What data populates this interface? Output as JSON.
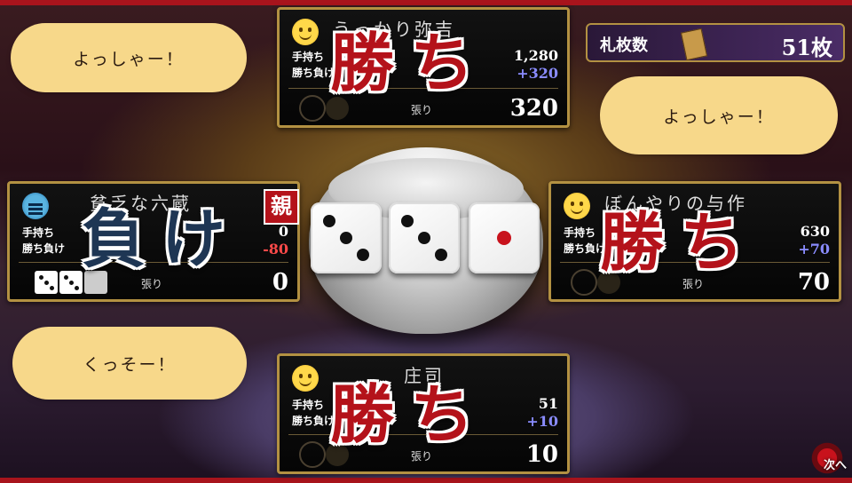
{
  "counter": {
    "label": "札枚数",
    "value": "51枚"
  },
  "players": {
    "top": {
      "name": "うっかり弥吉",
      "hand_label": "手持ち",
      "result_label": "勝ち負け",
      "hand": "1,280",
      "delta": "+320",
      "bet_label": "張り",
      "bet": "320",
      "result": "勝ち"
    },
    "left": {
      "name": "貧乏な六蔵",
      "hand_label": "手持ち",
      "result_label": "勝ち負け",
      "hand": "0",
      "delta": "-80",
      "bet_label": "張り",
      "bet": "0",
      "result": "負け",
      "dealer_badge": "親"
    },
    "right": {
      "name": "ぼんやりの与作",
      "hand_label": "手持ち",
      "result_label": "勝ち負け",
      "hand": "630",
      "delta": "+70",
      "bet_label": "張り",
      "bet": "70",
      "result": "勝ち"
    },
    "bottom": {
      "name": "庄司",
      "hand_label": "手持ち",
      "result_label": "勝ち負け",
      "hand": "51",
      "delta": "+10",
      "bet_label": "張り",
      "bet": "10",
      "result": "勝ち"
    }
  },
  "bubbles": {
    "top_left": "よっしゃー！",
    "right": "よっしゃー！",
    "bottom_left": "くっそー！"
  },
  "dice": [
    3,
    3,
    1
  ],
  "next_button": "次へ"
}
